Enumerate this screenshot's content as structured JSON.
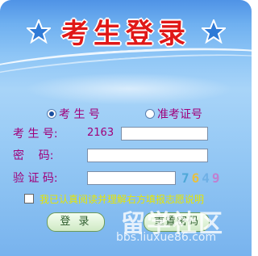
{
  "title": "考生登录",
  "login_type": {
    "option1": "考 生 号",
    "option2": "准考证号",
    "selected": "考 生 号"
  },
  "fields": {
    "exam_no_label": "考 生 号:",
    "exam_no_value": "2163",
    "password_label": "密    码:",
    "captcha_label": "验 证 码:"
  },
  "captcha": {
    "digit1": "7",
    "digit2": "6",
    "digit3": "4",
    "digit4": "9",
    "colors": [
      "#4fa8d8",
      "#e8c040",
      "#6fb0e6",
      "#c080d0"
    ]
  },
  "agreement": "我已认真阅读并理解右方填报志愿说明",
  "buttons": {
    "login": "登 录",
    "reset": "重置密码"
  },
  "watermark": {
    "logo": "留学社区",
    "url": "bbs.liuxue86.com"
  }
}
